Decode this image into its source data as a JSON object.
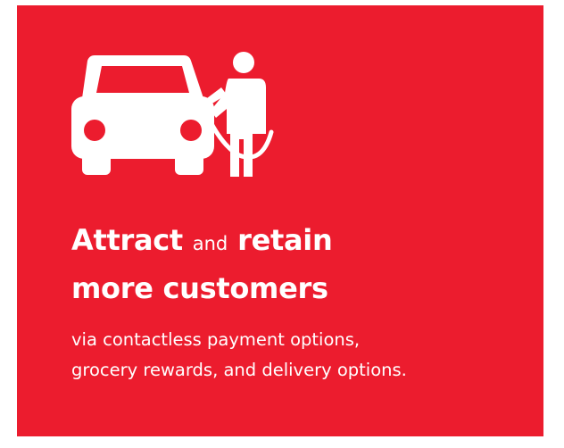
{
  "colors": {
    "card_background": "#ec1c2e",
    "foreground": "#ffffff"
  },
  "illustration": {
    "icon": "car-fueling-icon"
  },
  "headline": {
    "word1": "Attract",
    "connector": "and",
    "word2": "retain",
    "line2": "more customers"
  },
  "subtitle": {
    "line1": "via contactless payment options,",
    "line2": "grocery rewards, and delivery options."
  }
}
